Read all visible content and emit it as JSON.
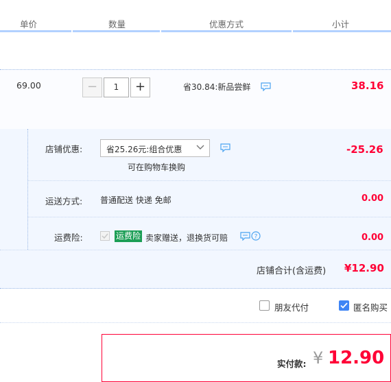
{
  "table_header": {
    "columns": [
      "单价",
      "数量",
      "优惠方式",
      "小计"
    ]
  },
  "item": {
    "unit_price": "69.00",
    "quantity": "1",
    "decrease_label": "−",
    "increase_label": "+",
    "promotion": "省30.84:新品尝鲜",
    "subtotal": "38.16"
  },
  "shop": {
    "discount": {
      "label": "店铺优惠:",
      "selected": "省25.26元:组合优惠",
      "note": "可在购物车换购",
      "amount": "-25.26"
    },
    "shipping": {
      "label": "运送方式:",
      "value": "普通配送 快递 免邮",
      "amount": "0.00"
    },
    "insurance": {
      "label": "运费险:",
      "badge": "运费险",
      "desc": "卖家赠送，退换货可赔",
      "amount": "0.00"
    },
    "total_label": "店铺合计(含运费)",
    "total_value": "¥12.90"
  },
  "options": {
    "friend_pay": {
      "label": "朋友代付",
      "checked": false
    },
    "anonymous": {
      "label": "匿名购买",
      "checked": true
    }
  },
  "payment": {
    "label": "实付款:",
    "currency": "¥",
    "amount": "12.90"
  },
  "colors": {
    "accent_red": "#ff0036",
    "header_line": "#b2d1ff",
    "section_bg": "#f2f7ff",
    "badge_green": "#1c9e56",
    "checkbox_blue": "#3f85f5",
    "icon_blue": "#4aa3f0"
  }
}
